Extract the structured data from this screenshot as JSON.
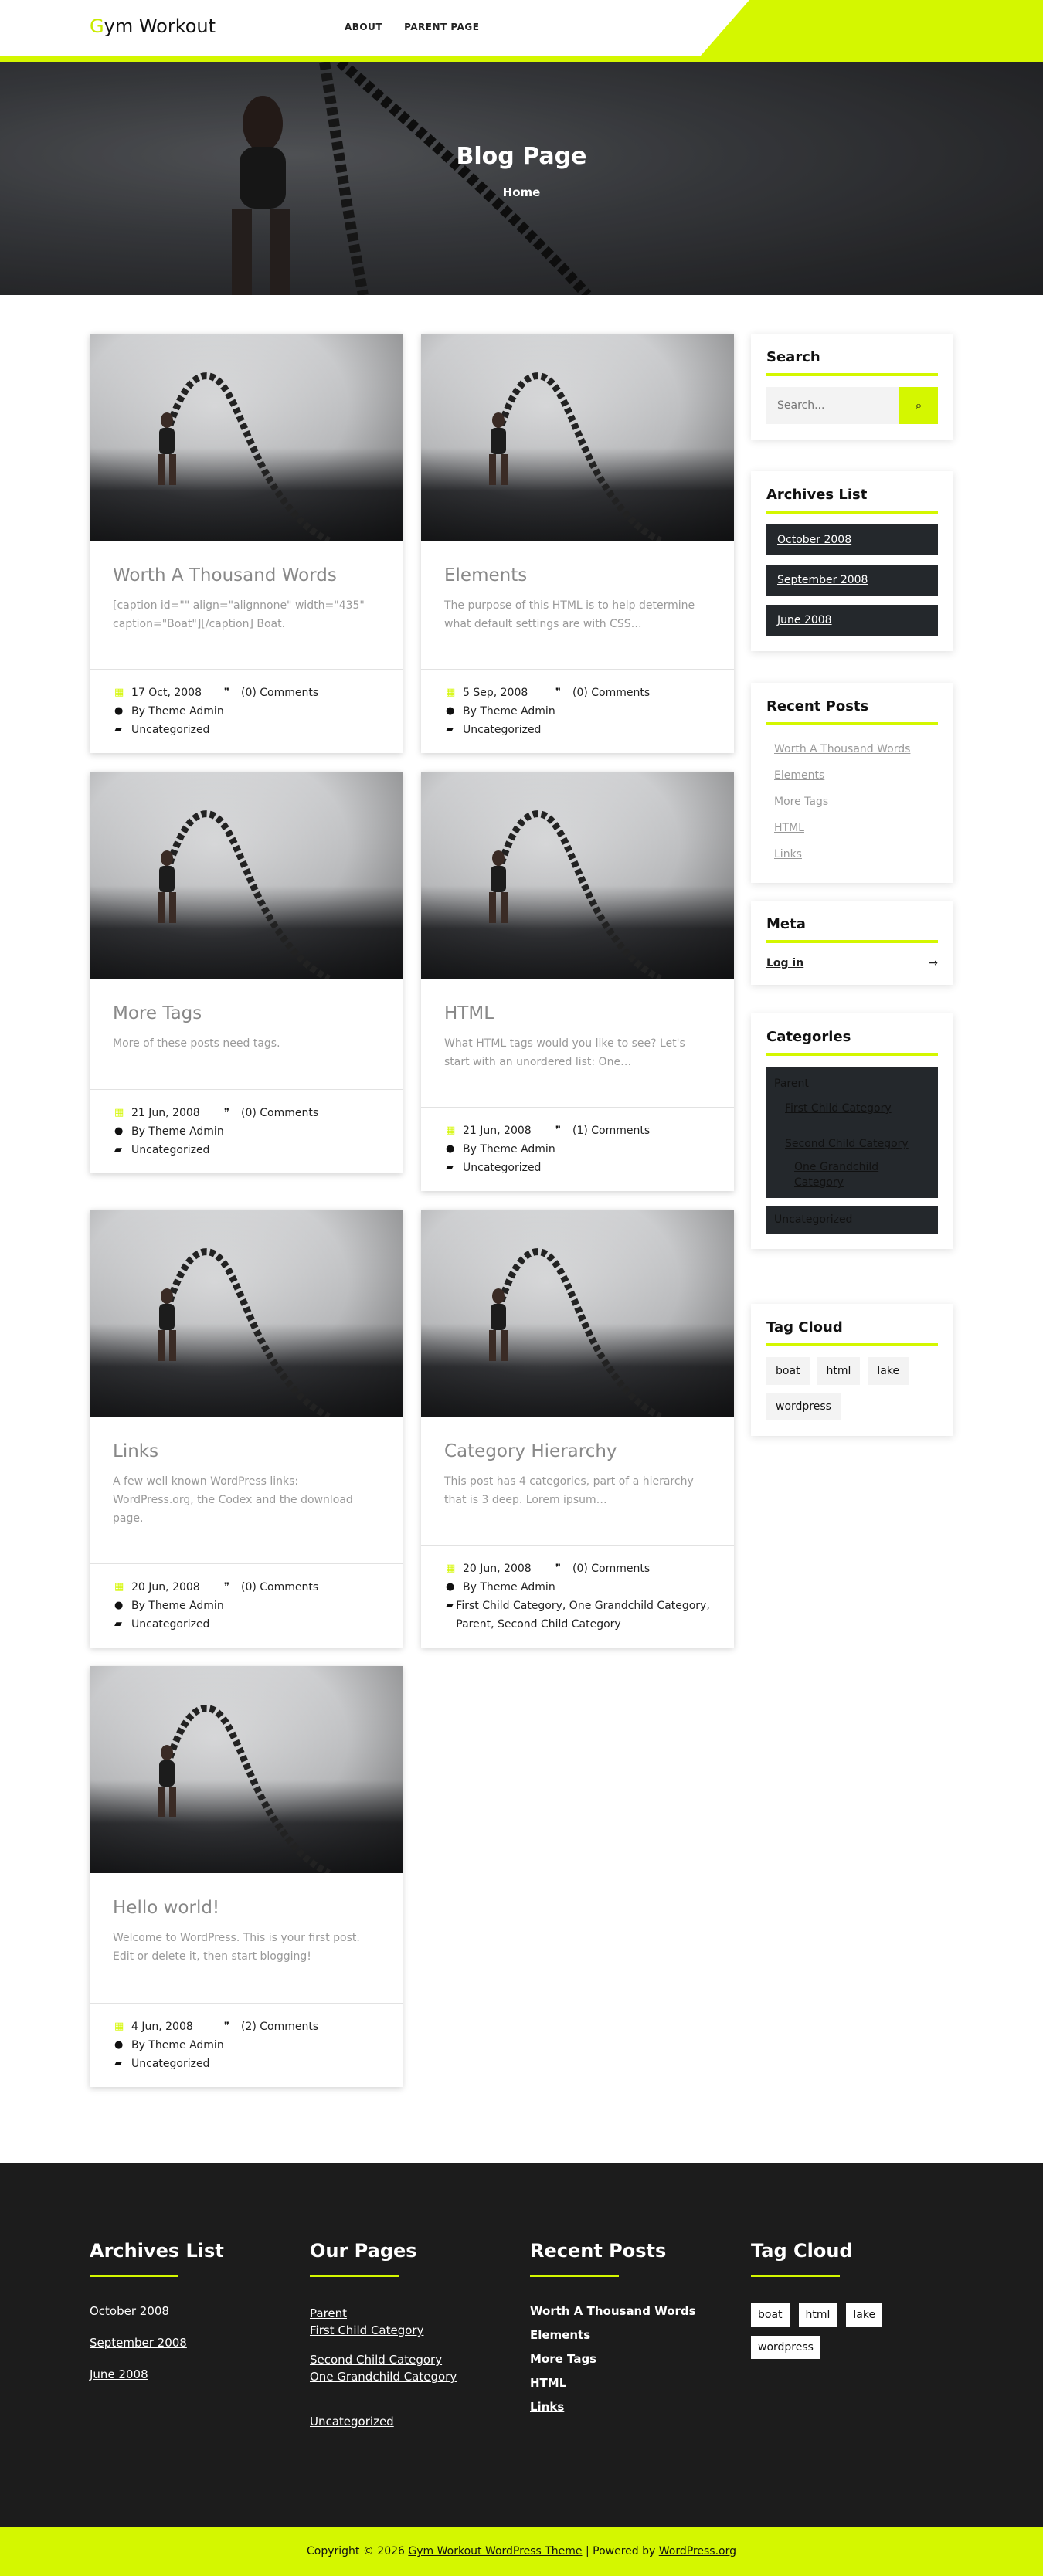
{
  "site": {
    "logo_first": "G",
    "logo_rest": "ym Workout"
  },
  "nav": {
    "about": "ABOUT",
    "parent_page": "PARENT PAGE"
  },
  "hero": {
    "title": "Blog Page",
    "crumb": "Home"
  },
  "posts": [
    {
      "title": "Worth A Thousand Words",
      "excerpt": "[caption id=\"\" align=\"alignnone\" width=\"435\" caption=\"Boat\"][/caption] Boat.",
      "date": "17 Oct, 2008",
      "comments": "(0) Comments",
      "author": "By Theme Admin",
      "categories": "Uncategorized"
    },
    {
      "title": "Elements",
      "excerpt": "The purpose of this HTML is to help determine what default settings are with CSS…",
      "date": "5 Sep, 2008",
      "comments": "(0) Comments",
      "author": "By Theme Admin",
      "categories": "Uncategorized"
    },
    {
      "title": "More Tags",
      "excerpt": "More of these posts need tags.",
      "date": "21 Jun, 2008",
      "comments": "(0) Comments",
      "author": "By Theme Admin",
      "categories": "Uncategorized"
    },
    {
      "title": "HTML",
      "excerpt": "What HTML tags would you like to see? Let's start with an unordered list: One…",
      "date": "21 Jun, 2008",
      "comments": "(1) Comments",
      "author": "By Theme Admin",
      "categories": "Uncategorized"
    },
    {
      "title": "Links",
      "excerpt": "A few well known WordPress links: WordPress.org, the Codex and the download page.",
      "date": "20 Jun, 2008",
      "comments": "(0) Comments",
      "author": "By Theme Admin",
      "categories": "Uncategorized"
    },
    {
      "title": "Category Hierarchy",
      "excerpt": "This post has 4 categories, part of a hierarchy that is 3 deep. Lorem ipsum…",
      "date": "20 Jun, 2008",
      "comments": "(0) Comments",
      "author": "By Theme Admin",
      "categories": "First Child Category, One Grandchild Category, Parent, Second Child Category"
    },
    {
      "title": "Hello world!",
      "excerpt": "Welcome to WordPress. This is your first post. Edit or delete it, then start blogging!",
      "date": "4 Jun, 2008",
      "comments": "(2) Comments",
      "author": "By Theme Admin",
      "categories": "Uncategorized"
    }
  ],
  "sidebar": {
    "search": {
      "title": "Search",
      "placeholder": "Search..."
    },
    "archives": {
      "title": "Archives List",
      "items": [
        "October 2008",
        "September 2008",
        "June 2008"
      ]
    },
    "recent": {
      "title": "Recent Posts",
      "items": [
        "Worth A Thousand Words",
        "Elements",
        "More Tags",
        "HTML",
        "Links"
      ]
    },
    "meta": {
      "title": "Meta",
      "login": "Log in",
      "arrow": "→"
    },
    "categories": {
      "title": "Categories",
      "parent": "Parent",
      "first_child": "First Child Category",
      "second_child": "Second Child Category",
      "grandchild": "One Grandchild Category",
      "uncategorized": "Uncategorized"
    },
    "tags": {
      "title": "Tag Cloud",
      "items": [
        "boat",
        "html",
        "lake",
        "wordpress"
      ]
    }
  },
  "footer": {
    "archives": {
      "title": "Archives List",
      "items": [
        "October 2008",
        "September 2008",
        "June 2008"
      ]
    },
    "pages": {
      "title": "Our Pages",
      "parent": "Parent",
      "first_child": "First Child Category",
      "second_child": "Second Child Category",
      "grandchild": "One Grandchild Category",
      "uncategorized": "Uncategorized"
    },
    "recent": {
      "title": "Recent Posts",
      "items": [
        "Worth A Thousand Words",
        "Elements",
        "More Tags",
        "HTML",
        "Links"
      ]
    },
    "tags": {
      "title": "Tag Cloud",
      "items": [
        "boat",
        "html",
        "lake",
        "wordpress"
      ]
    },
    "copyright_prefix": "Copyright © 2026",
    "theme_link": "Gym Workout WordPress Theme",
    "powered_prefix": "| Powered by",
    "wp_link": "WordPress.org"
  },
  "colors": {
    "accent": "#d4f700",
    "dark": "#24282c",
    "footer": "#1c1c1c"
  },
  "icons": {
    "date": "calendar-icon",
    "comments": "comments-icon",
    "author": "user-icon",
    "category": "folder-icon",
    "search": "search-icon"
  }
}
